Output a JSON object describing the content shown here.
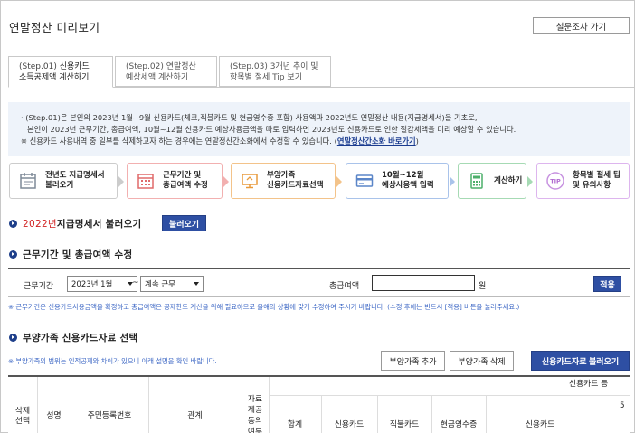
{
  "page": {
    "title": "연말정산 미리보기",
    "survey_button": "설문조사 가기"
  },
  "tabs": [
    {
      "step": "(Step.01)",
      "line1_rest": " 신용카드",
      "line2": "소득공제액 계산하기"
    },
    {
      "step": "(Step.02)",
      "line1_rest": " 연말정산",
      "line2": "예상세액 계산하기"
    },
    {
      "step": "(Step.03)",
      "line1_rest": " 3개년 추이 및",
      "line2": "항목별 절세 Tip 보기"
    }
  ],
  "info": {
    "line1": "· (Step.01)은 본인의 2023년 1월~9월 신용카드(체크,직불카드 및 현금영수증 포함) 사용액과 2022년도 연말정산 내용(지급명세서)을 기초로,",
    "line2": "  본인이 2023년 근무기간, 총급여액, 10월~12월 신용카드 예상사용금액을 따로 입력하면 2023년도 신용카드로 인한 절감세액을 미리 예상할 수 있습니다.",
    "line3_text": "※ 신용카드 사용내역 중 일부를 삭제하고자 하는 경우에는 연말정산간소화에서 수정할 수 있습니다. (",
    "line3_link": "연말정산간소화 바로가기",
    "line3_end": ")"
  },
  "steps": [
    {
      "line1": "전년도 지급명세서",
      "line2": "불러오기",
      "icon": "calendar-doc-icon",
      "color": "#7f8a98"
    },
    {
      "line1": "근무기간 및",
      "line2": "총급여액 수정",
      "icon": "calendar-icon",
      "color": "#e06a6a"
    },
    {
      "line1": "부양가족",
      "line2": "신용카드자료선택",
      "icon": "monitor-icon",
      "color": "#e89a3c"
    },
    {
      "line1": "10월~12월",
      "line2": "예상사용액 입력",
      "icon": "credit-card-icon",
      "color": "#5b86c8"
    },
    {
      "line1": "계산하기",
      "line2": "",
      "icon": "calculator-icon",
      "color": "#4caf6a"
    },
    {
      "line1": "항목별 절세 팁",
      "line2": "및 유의사항",
      "icon": "tip-icon",
      "color": "#b06ad0"
    }
  ],
  "section1": {
    "year": "2022년",
    "title": " 지급명세서 불러오기",
    "button": "불러오기"
  },
  "section2": {
    "title": "근무기간 및 총급여액 수정"
  },
  "work": {
    "label": "근무기간",
    "start_value": "2023년 1월",
    "tilde": "~",
    "end_value": "계속 근무",
    "salary_label": "총급여액",
    "unit": "원",
    "apply_button": "적용"
  },
  "note1": "※ 근무기간은 신용카드사용금액을 확정하고 총급여액은 공제한도 계산을 위해 필요하므로 올해의 상황에 맞게 수정하여 주시기 바랍니다. (수정 후에는 반드시 [적용] 버튼을 눌러주세요.)",
  "section3": {
    "title": "부양가족 신용카드자료 선택"
  },
  "note2": "※ 부양가족의 범위는 인적공제와 차이가 있으니 아래 설명을 확인 바랍니다.",
  "buttons3": {
    "add": "부양가족 추가",
    "delete": "부양가족 삭제",
    "load": "신용카드자료 불러오기"
  },
  "table": {
    "delete_select": [
      "삭제",
      "선택"
    ],
    "name": "성명",
    "rrn": "주민등록번호",
    "relation": "관계",
    "provide": [
      "자료",
      "제공",
      "동의",
      "여부"
    ],
    "card_group": "신용카드 등",
    "sub_num": "5",
    "total": "합계",
    "credit_card": "신용카드",
    "debit_card": "직불카드",
    "cash_receipt": "현금영수증",
    "credit_card2": "신용카드"
  },
  "colors": {
    "navy": "#2e4fa3",
    "link": "#1a3b8f",
    "note": "#3b66c4",
    "info_bg": "#eef3fa",
    "red": "#d02020"
  }
}
